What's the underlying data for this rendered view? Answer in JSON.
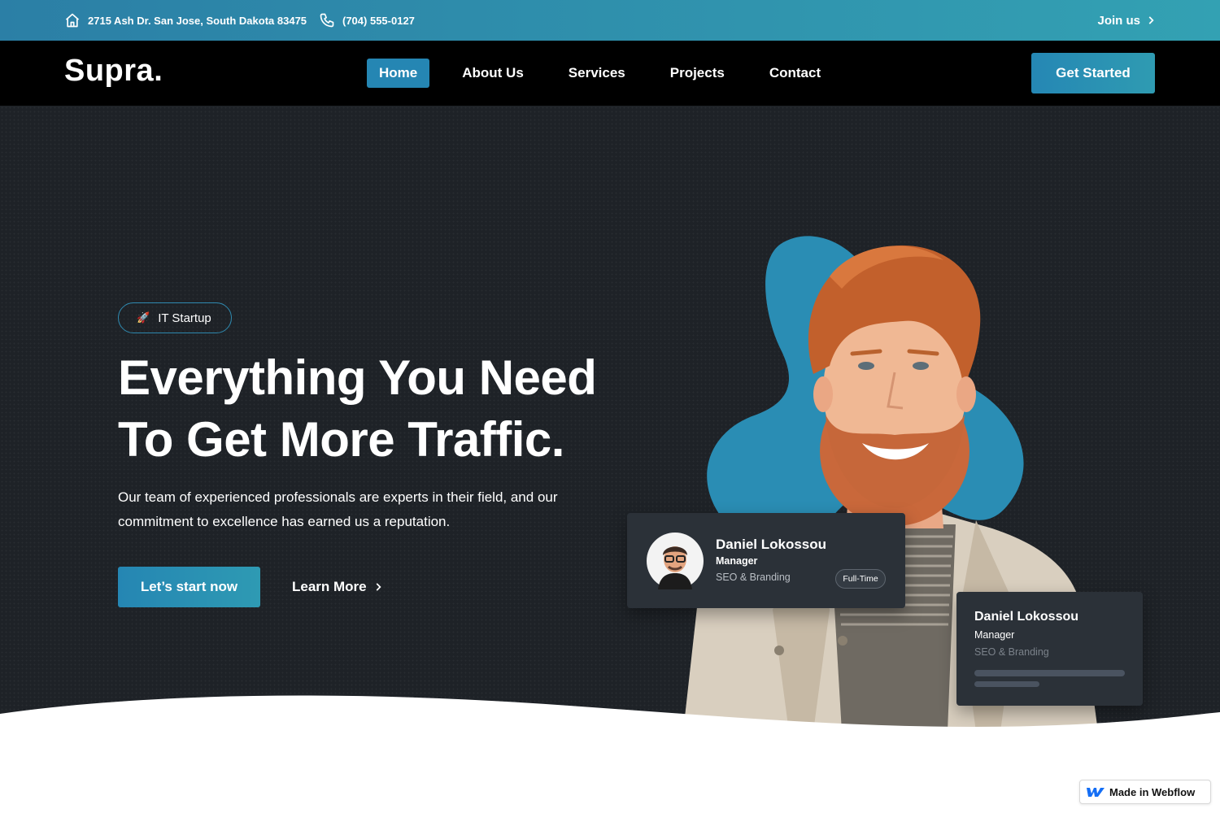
{
  "topbar": {
    "address": "2715 Ash Dr. San Jose, South Dakota 83475",
    "phone": "(704) 555-0127",
    "join_label": "Join us",
    "address_icon": "home-icon",
    "phone_icon": "phone-icon"
  },
  "nav": {
    "logo": "Supra.",
    "items": [
      {
        "label": "Home",
        "active": true
      },
      {
        "label": "About Us"
      },
      {
        "label": "Services"
      },
      {
        "label": "Projects"
      },
      {
        "label": "Contact"
      }
    ],
    "cta_label": "Get Started"
  },
  "hero": {
    "tag_label": "IT Startup",
    "tag_icon": "🚀",
    "headline_line1": "Everything You Need",
    "headline_line2": "To Get More Traffic.",
    "lead_line1": "Our team of experienced professionals are experts in their field, and our",
    "lead_line2": "commitment to excellence has earned us a reputation.",
    "primary_button": "Let’s start now",
    "secondary_button": "Learn More"
  },
  "profile_card": {
    "name": "Daniel Lokossou",
    "role": "Manager",
    "department": "SEO & Branding",
    "badge": "Full-Time"
  },
  "profile_card_2": {
    "name": "Daniel Lokossou",
    "role": "Manager",
    "department": "SEO & Branding"
  },
  "webflow_badge": "Made in Webflow",
  "colors": {
    "accent": "#2586b3",
    "accent_light": "#33a1b3",
    "nav_bg": "#000000",
    "hero_bg": "#1e2227",
    "card_bg": "#2b3138"
  }
}
